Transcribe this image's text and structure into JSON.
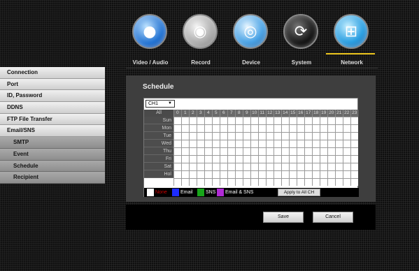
{
  "topnav": {
    "items": [
      {
        "label": "Video / Audio",
        "icon": "video-audio-icon"
      },
      {
        "label": "Record",
        "icon": "record-icon"
      },
      {
        "label": "Device",
        "icon": "device-icon"
      },
      {
        "label": "System",
        "icon": "system-icon"
      },
      {
        "label": "Network",
        "icon": "network-icon"
      }
    ],
    "active": "Network",
    "accent": "#e8c21a"
  },
  "sidebar": {
    "items": [
      "Connection",
      "Port",
      "ID, Password",
      "DDNS",
      "FTP File Transfer",
      "Email/SNS"
    ],
    "subitems": [
      "SMTP",
      "Event",
      "Schedule",
      "Recipient"
    ],
    "active": "Schedule"
  },
  "panel": {
    "title": "Schedule",
    "channel": "CH1",
    "all_label": "All",
    "hours": [
      "0",
      "1",
      "2",
      "3",
      "4",
      "5",
      "6",
      "7",
      "8",
      "9",
      "10",
      "11",
      "12",
      "13",
      "14",
      "15",
      "16",
      "17",
      "18",
      "19",
      "20",
      "21",
      "22",
      "23"
    ],
    "days": [
      "Sun",
      "Mon",
      "Tue",
      "Wed",
      "Thu",
      "Fri",
      "Sat",
      "Hol"
    ]
  },
  "legend": {
    "none_label": "None",
    "email_label": "Email",
    "sns_label": "SNS",
    "email_sns_label": "Email & SNS",
    "apply_label": "Apply to All CH",
    "colors": {
      "none": "#ffffff",
      "email": "#1d2cff",
      "sns": "#18a51a",
      "email_sns": "#b12bd6",
      "none_text": "#d30000"
    }
  },
  "buttons": {
    "save": "Save",
    "cancel": "Cancel"
  }
}
